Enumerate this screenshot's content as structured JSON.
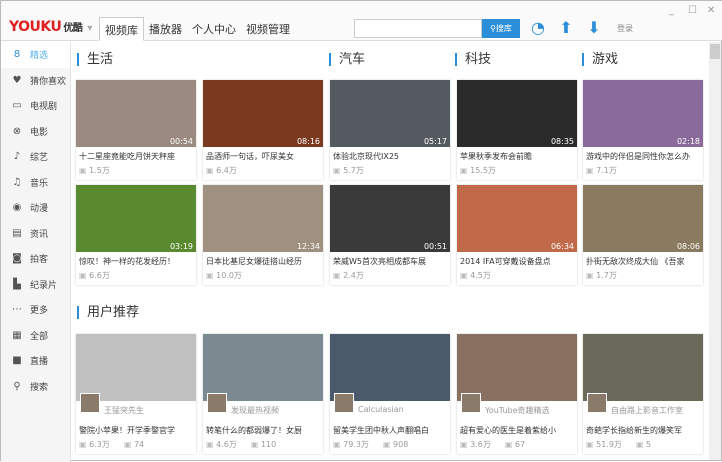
{
  "app": {
    "logo": "YOUKU",
    "logo_cn": "优酷",
    "login": "登录",
    "search_label": "搜库",
    "search_placeholder": ""
  },
  "nav": [
    "视频库",
    "播放器",
    "个人中心",
    "视频管理"
  ],
  "sidebar": [
    {
      "icon": "8",
      "label": "精选"
    },
    {
      "icon": "♥",
      "label": "猜你喜欢"
    },
    {
      "icon": "▭",
      "label": "电视剧"
    },
    {
      "icon": "⊗",
      "label": "电影"
    },
    {
      "icon": "♪",
      "label": "综艺"
    },
    {
      "icon": "♫",
      "label": "音乐"
    },
    {
      "icon": "◉",
      "label": "动漫"
    },
    {
      "icon": "▤",
      "label": "资讯"
    },
    {
      "icon": "◙",
      "label": "拍客"
    },
    {
      "icon": "▙",
      "label": "纪录片"
    },
    {
      "icon": "⋯",
      "label": "更多"
    },
    {
      "icon": "▦",
      "label": "全部"
    },
    {
      "icon": "■",
      "label": "直播"
    },
    {
      "icon": "⚲",
      "label": "搜索"
    }
  ],
  "sections": [
    "生活",
    "汽车",
    "科技",
    "游戏",
    "用户推荐"
  ],
  "row1": [
    {
      "title": "十二星座竟能吃月饼天秤座",
      "views": "1.5万",
      "dur": "00:54",
      "color": "#9a8a80"
    },
    {
      "title": "品酒师一句话，吓尿美女",
      "views": "6.4万",
      "dur": "08:16",
      "color": "#7a3a20"
    },
    {
      "title": "体验北京现代IX25",
      "views": "5.7万",
      "dur": "05:17",
      "color": "#555a60"
    },
    {
      "title": "苹果秋季发布会前瞻",
      "views": "15.5万",
      "dur": "08:35",
      "color": "#2a2a2a"
    },
    {
      "title": "游戏中的伴侣是同性你怎么办",
      "views": "7.1万",
      "dur": "02:18",
      "color": "#8a6a9a"
    }
  ],
  "row2": [
    {
      "title": "惊叹！神一样的花发经历！",
      "views": "6.6万",
      "dur": "03:19",
      "color": "#5a8a30"
    },
    {
      "title": "日本比基尼女爆徒搭山经历",
      "views": "10.0万",
      "dur": "12:34",
      "color": "#a09080"
    },
    {
      "title": "荣威W5首次亮相成都车展",
      "views": "2.4万",
      "dur": "00:51",
      "color": "#3a3a3a"
    },
    {
      "title": "2014 IFA可穿戴设备盘点",
      "views": "4.5万",
      "dur": "06:34",
      "color": "#c06a4a"
    },
    {
      "title": "扑街无敌次终成大仙 《吾家",
      "views": "1.7万",
      "dur": "08:06",
      "color": "#8a7a60"
    }
  ],
  "row3": [
    {
      "author": "王猛突先生",
      "title": "警院小苹果！开学季警官学",
      "views": "6.3万",
      "comments": "74",
      "color": "#c0c0c0"
    },
    {
      "author": "发现最热视频",
      "title": "转笔什么的都弱爆了！女厨",
      "views": "4.6万",
      "comments": "110",
      "color": "#7a8a90"
    },
    {
      "author": "Calculasian",
      "title": "留美学生团中秋人声翻唱白",
      "views": "79.3万",
      "comments": "908",
      "color": "#4a5a6a"
    },
    {
      "author": "YouTube奇趣精选",
      "title": "超有爱心的医生是着紫给小",
      "views": "3.6万",
      "comments": "67",
      "color": "#8a7060"
    },
    {
      "author": "自由路上影音工作室",
      "title": "奇葩学长指给新生的爆笑军",
      "views": "51.9万",
      "comments": "5",
      "color": "#6a6a5a"
    }
  ]
}
